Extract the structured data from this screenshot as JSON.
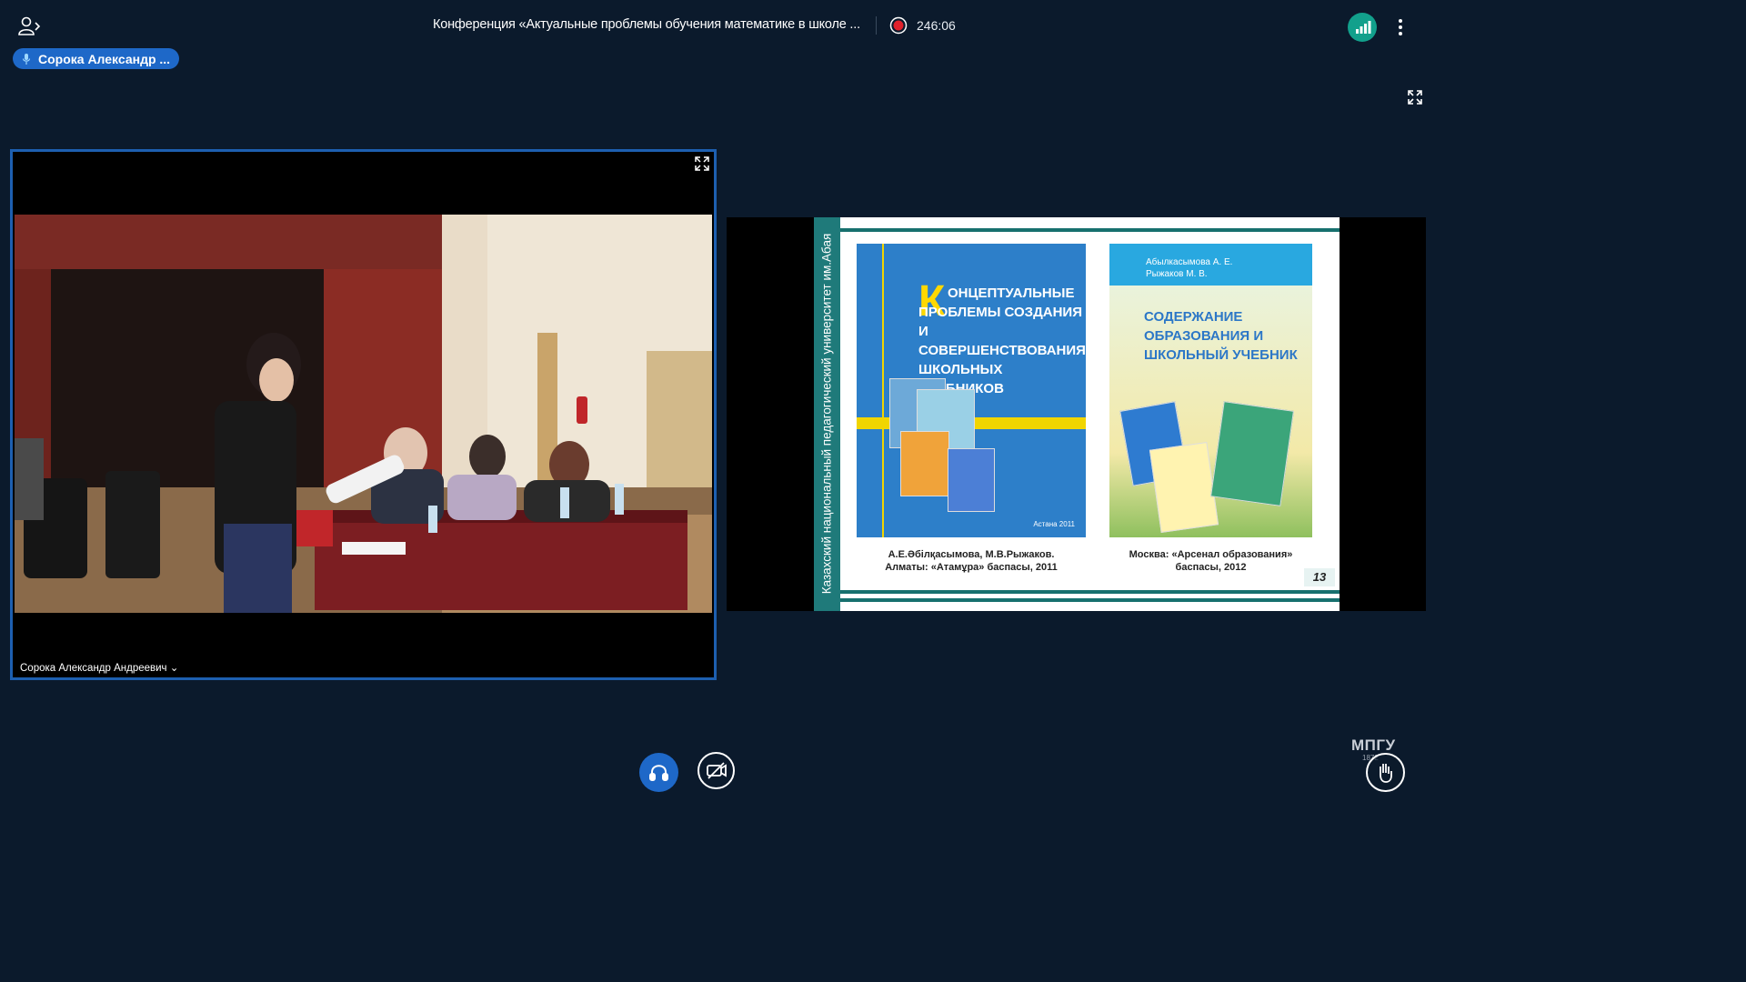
{
  "topbar": {
    "users_icon": "users-list-icon",
    "conference_title": "Конференция «Актуальные проблемы обучения математике в школе ...",
    "recording_icon": "record-icon",
    "timer": "246:06",
    "signal_icon": "connection-status-icon",
    "menu_icon": "more-options-icon"
  },
  "presenter": {
    "name": "Сорока Александр ...",
    "icon": "mic-icon"
  },
  "video": {
    "participant_name": "Сорока Александр Андреевич",
    "dropdown_glyph": "⌄"
  },
  "slide": {
    "side_text": "Казахский национальный педагогический университет им.Абая",
    "book1": {
      "title_first_letter": "К",
      "title": "онцептуальные проблемы создания и совершенствования школьных учебников",
      "city": "Астана 2011",
      "caption_line1": "А.Е.Әбілқасымова, М.В.Рыжаков.",
      "caption_line2": "Алматы: «Атамұра» баспасы, 2011"
    },
    "book2": {
      "author1": "Абылкасымова А. Е.",
      "author2": "Рыжаков М. В.",
      "title": "Содержание образования и школьный учебник",
      "caption_line1": "Москва: «Арсенал образования»",
      "caption_line2": "баспасы, 2012"
    },
    "page_number": "13"
  },
  "logo": {
    "text": "МПГУ",
    "year": "1872"
  },
  "colors": {
    "background": "#0b1a2c",
    "accent_blue": "#1e68c8",
    "signal_green": "#12a08c",
    "slide_teal": "#1f7a7a"
  }
}
